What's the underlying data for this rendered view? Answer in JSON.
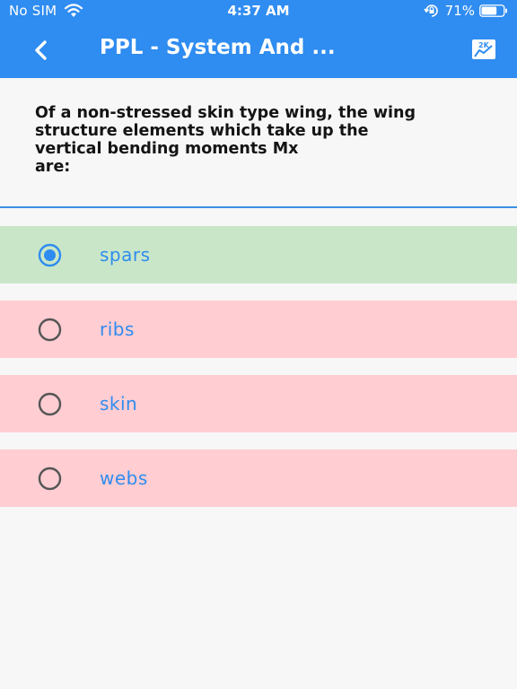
{
  "status_bar": {
    "carrier": "No SIM",
    "time": "4:37 AM",
    "battery_percent": "71%",
    "battery_level": 0.71,
    "icons": [
      "wifi-icon",
      "lock-rotation-icon",
      "battery-icon"
    ]
  },
  "app_bar": {
    "title": "PPL - System And ...",
    "back_icon": "chevron-left-icon",
    "action_icon": "chart-icon",
    "color": "#2f8cf0"
  },
  "question": {
    "text": "Of a non-stressed skin type wing, the wing\nstructure elements which take up the\nvertical bending moments Mx\nare:"
  },
  "options": [
    {
      "label": "spars",
      "selected": true,
      "status": "correct"
    },
    {
      "label": "ribs",
      "selected": false,
      "status": "wrong"
    },
    {
      "label": "skin",
      "selected": false,
      "status": "wrong"
    },
    {
      "label": "webs",
      "selected": false,
      "status": "wrong"
    }
  ],
  "colors": {
    "accent": "#2f8cf0",
    "correct_bg": "#c9e7c8",
    "wrong_bg": "#ffcdd2"
  }
}
